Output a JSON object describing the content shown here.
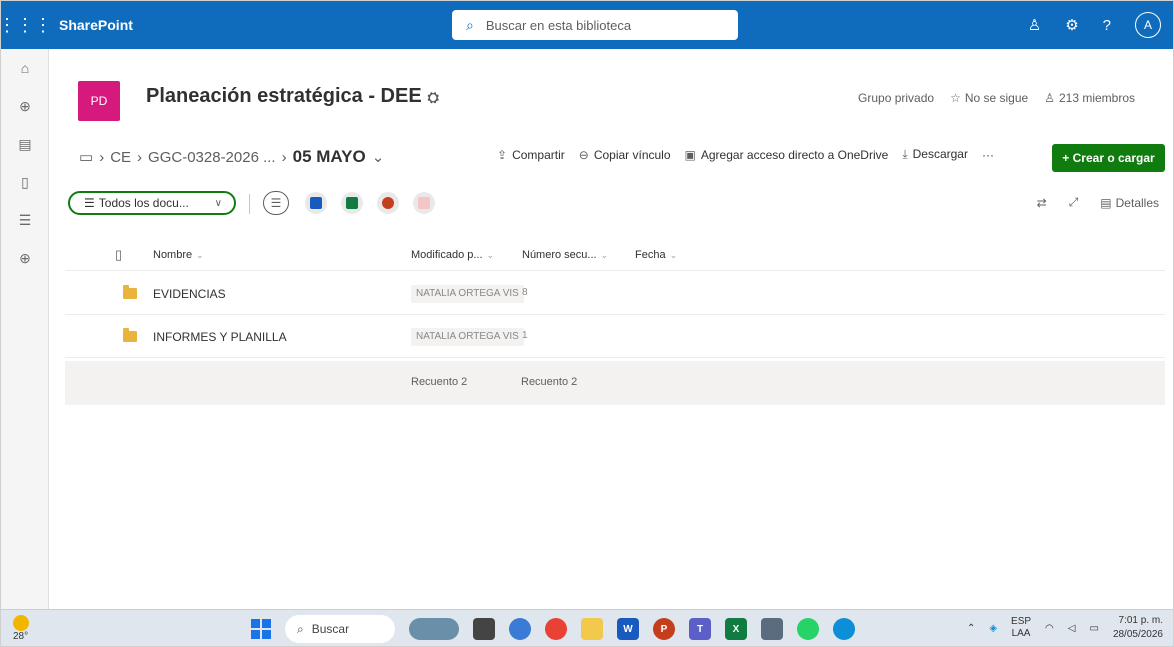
{
  "suite": {
    "app_name": "SharePoint",
    "search_placeholder": "Buscar en esta biblioteca",
    "avatar_initial": "A"
  },
  "site": {
    "logo_initials": "PD",
    "logo_color": "#d6197d",
    "title": "Planeación estratégica - DEE",
    "group_type": "Grupo privado",
    "follow_label": "No se sigue",
    "members_label": "213 miembros"
  },
  "breadcrumb": {
    "items": [
      "CE",
      "GGC-0328-2026 ..."
    ],
    "current": "05 MAYO"
  },
  "commands": {
    "share": "Compartir",
    "copy_link": "Copiar vínculo",
    "shortcut": "Agregar acceso directo a OneDrive",
    "download": "Descargar",
    "more": "···",
    "create": "+ Crear o cargar"
  },
  "view": {
    "current": "Todos los docu...",
    "details": "Detalles"
  },
  "list": {
    "columns": {
      "name": "Nombre",
      "modified_by": "Modificado p...",
      "sequence": "Número secu...",
      "date": "Fecha"
    },
    "rows": [
      {
        "name": "EVIDENCIAS",
        "modified_by": "NATALIA ORTEGA VIS",
        "sequence": "8"
      },
      {
        "name": "INFORMES Y PLANILLA",
        "modified_by": "NATALIA ORTEGA VIS",
        "sequence": "1"
      }
    ],
    "footer": {
      "count1": "Recuento 2",
      "count2": "Recuento 2"
    }
  },
  "taskbar": {
    "weather_temp": "28°",
    "search_label": "Buscar",
    "lang_line1": "ESP",
    "lang_line2": "LAA",
    "time": "7:01 p. m.",
    "date": "28/05/2026"
  },
  "colors": {
    "suitebar": "#0f6cbd",
    "accent_green": "#107c10"
  }
}
